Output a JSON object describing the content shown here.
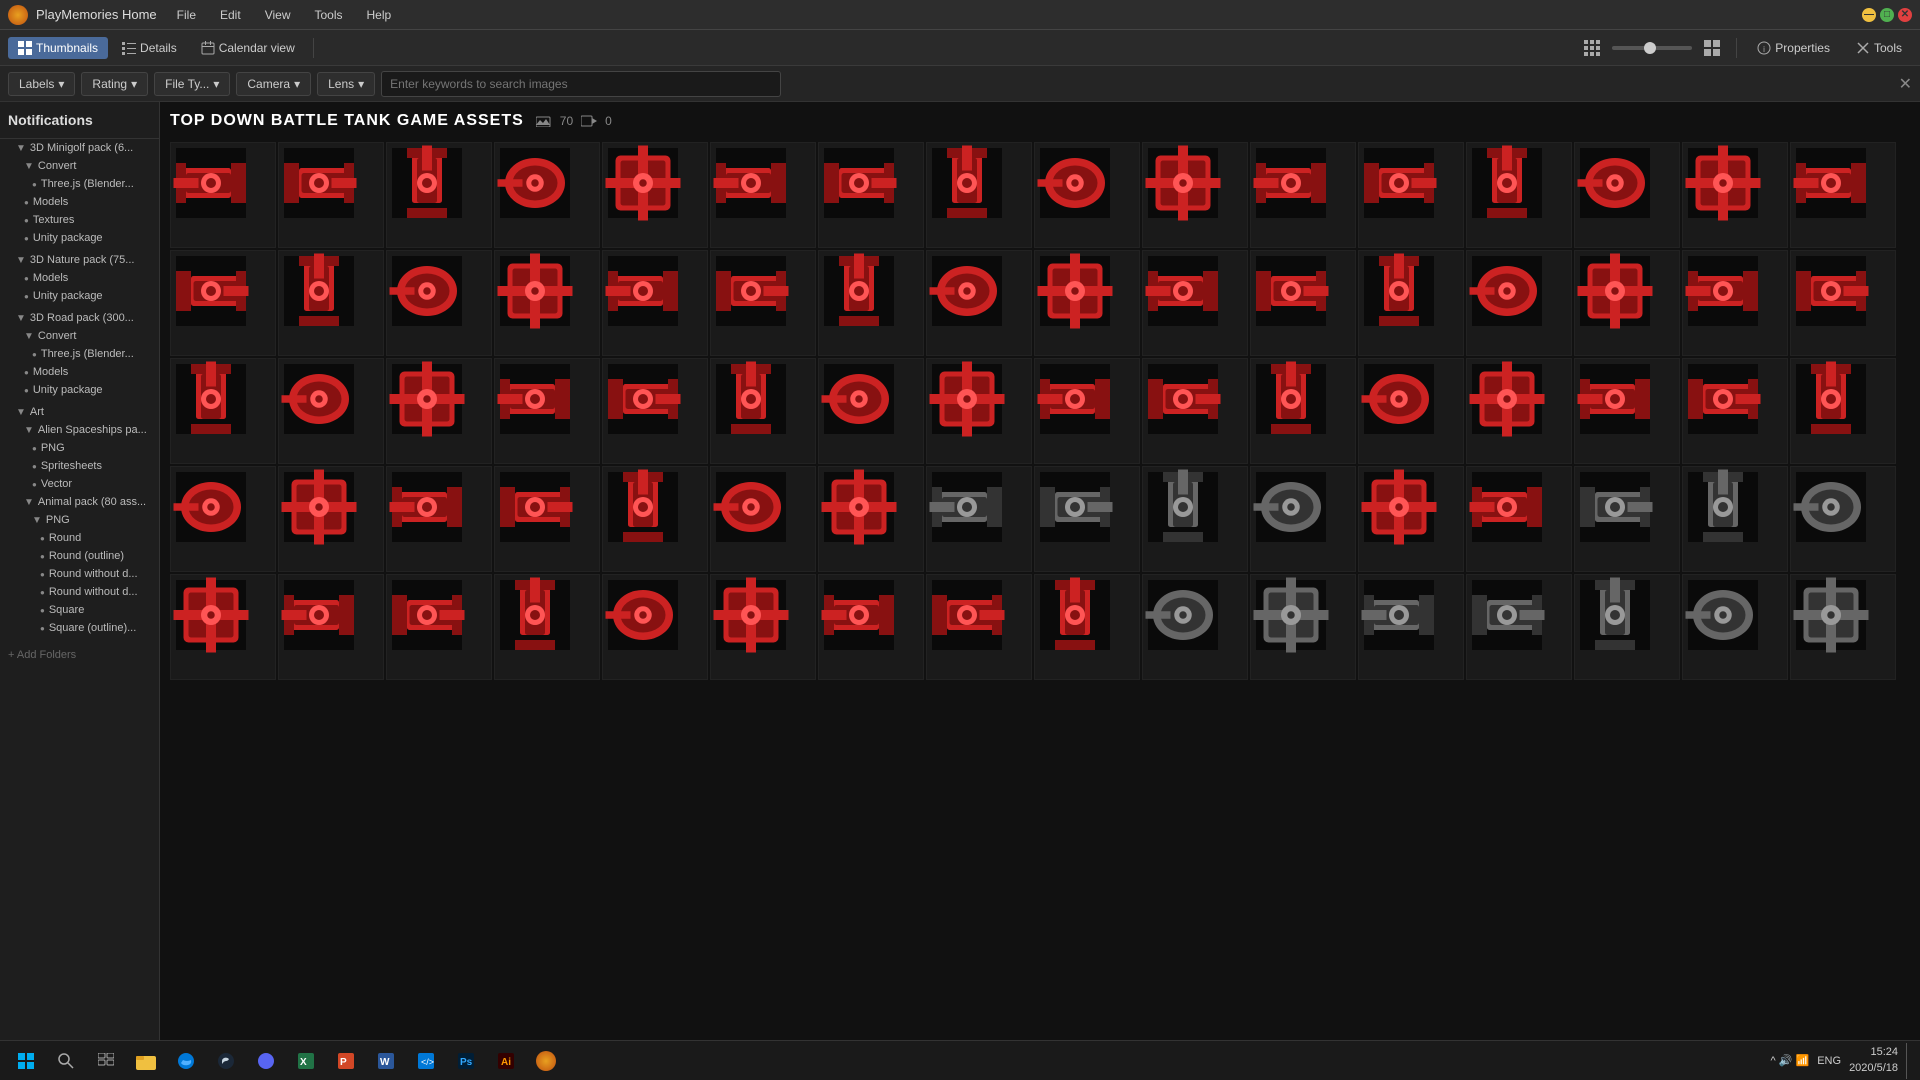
{
  "app": {
    "title": "PlayMemories Home",
    "logo_alt": "PlayMemories Logo"
  },
  "titlebar": {
    "menu_items": [
      "File",
      "Edit",
      "View",
      "Tools",
      "Help"
    ],
    "controls": {
      "minimize": "—",
      "maximize": "□",
      "close": "✕"
    }
  },
  "toolbar": {
    "thumbnails_label": "Thumbnails",
    "details_label": "Details",
    "calendar_label": "Calendar view",
    "properties_label": "Properties",
    "tools_label": "Tools"
  },
  "filterbar": {
    "labels_label": "Labels",
    "rating_label": "Rating",
    "filetype_label": "File Ty...",
    "camera_label": "Camera",
    "lens_label": "Lens",
    "search_placeholder": "Enter keywords to search images"
  },
  "sidebar": {
    "section_title": "Notifications",
    "groups": [
      {
        "name": "3D Minigolf pack (6...",
        "expanded": true,
        "children": [
          {
            "name": "Convert",
            "expanded": true,
            "children": [
              {
                "name": "Three.js (Blender..."
              }
            ]
          },
          {
            "name": "Models"
          },
          {
            "name": "Textures"
          },
          {
            "name": "Unity package"
          }
        ]
      },
      {
        "name": "3D Nature pack (75...",
        "expanded": true,
        "children": [
          {
            "name": "Models"
          },
          {
            "name": "Unity package"
          }
        ]
      },
      {
        "name": "3D Road pack (300...",
        "expanded": true,
        "children": [
          {
            "name": "Convert",
            "expanded": true,
            "children": [
              {
                "name": "Three.js (Blender..."
              }
            ]
          },
          {
            "name": "Models"
          },
          {
            "name": "Unity package"
          }
        ]
      },
      {
        "name": "Art",
        "expanded": true,
        "children": [
          {
            "name": "Alien Spaceships pa...",
            "expanded": true,
            "children": [
              {
                "name": "PNG"
              },
              {
                "name": "Spritesheets"
              },
              {
                "name": "Vector"
              }
            ]
          },
          {
            "name": "Animal pack (80 ass...",
            "expanded": true,
            "children": [
              {
                "name": "PNG",
                "expanded": true,
                "children": [
                  {
                    "name": "Round"
                  },
                  {
                    "name": "Round (outline)"
                  },
                  {
                    "name": "Round without d..."
                  },
                  {
                    "name": "Round without d..."
                  },
                  {
                    "name": "Square"
                  },
                  {
                    "name": "Square (outline)..."
                  }
                ]
              }
            ]
          }
        ]
      }
    ],
    "add_folders": "+ Add Folders"
  },
  "content": {
    "title": "TOP DOWN BATTLE TANK GAME ASSETS",
    "image_count": "70",
    "video_count": "0",
    "rows": 5,
    "cols": 16
  },
  "taskbar": {
    "start_label": "Start",
    "time": "15:24",
    "date": "2020/5/18",
    "apps": [
      "search",
      "task-view",
      "file-explorer",
      "edge",
      "flux",
      "steam",
      "discord",
      "excel",
      "powerpoint",
      "access",
      "publisher",
      "word",
      "vs-code",
      "git",
      "photoshop",
      "illustrator",
      "acrobat",
      "browser",
      "media",
      "playmemories",
      "unknown"
    ],
    "system_tray": "ENG"
  }
}
